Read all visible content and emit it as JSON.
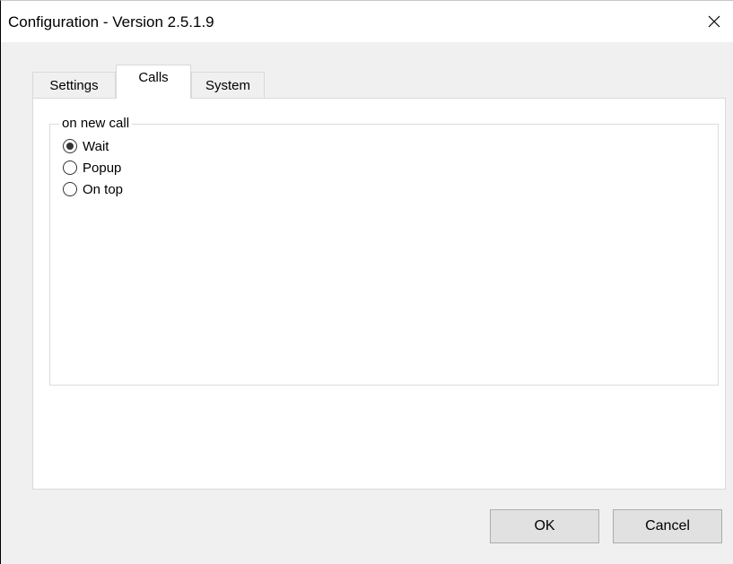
{
  "window": {
    "title": "Configuration - Version 2.5.1.9",
    "close_icon": "close-icon"
  },
  "tabs": [
    {
      "label": "Settings",
      "active": false
    },
    {
      "label": "Calls",
      "active": true
    },
    {
      "label": "System",
      "active": false
    }
  ],
  "calls_tab": {
    "group_label": "on new call",
    "options": [
      {
        "label": "Wait",
        "checked": true
      },
      {
        "label": "Popup",
        "checked": false
      },
      {
        "label": "On top",
        "checked": false
      }
    ]
  },
  "buttons": {
    "ok_label": "OK",
    "cancel_label": "Cancel"
  }
}
